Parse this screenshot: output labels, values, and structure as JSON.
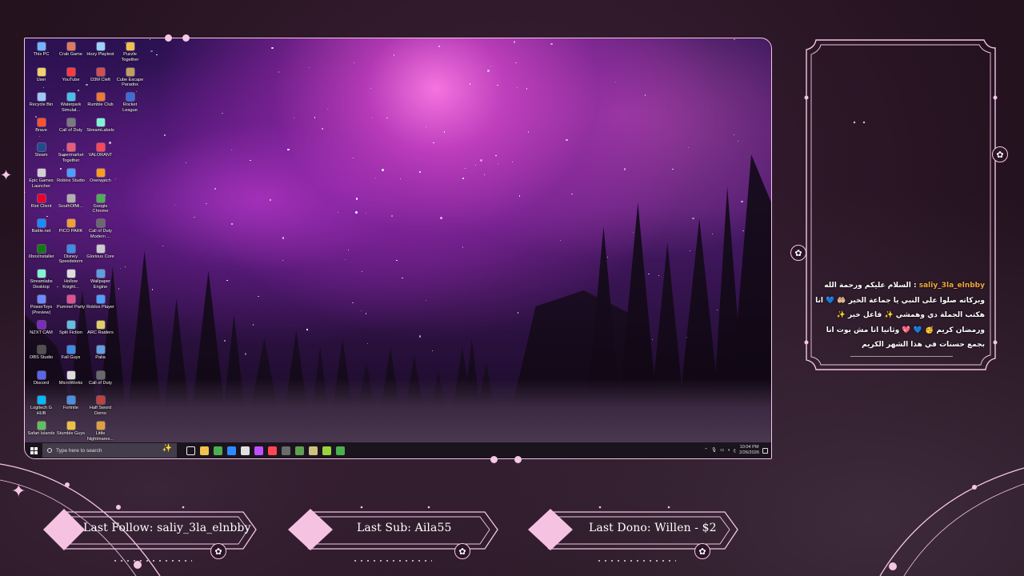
{
  "desktop": {
    "icons": [
      {
        "label": "This PC",
        "icon": "pc-icon",
        "color": "#6fb6ff"
      },
      {
        "label": "Crab Game",
        "icon": "game-icon",
        "color": "#e07a5f"
      },
      {
        "label": "Hozy Playtest",
        "icon": "game-icon",
        "color": "#9bd3ff"
      },
      {
        "label": "Puzzle Together",
        "icon": "game-icon",
        "color": "#f2c14e"
      },
      {
        "label": "User",
        "icon": "user-folder-icon",
        "color": "#f2d16b"
      },
      {
        "label": "YouTube",
        "icon": "youtube-icon",
        "color": "#ff3b3b"
      },
      {
        "label": "D3M Cleft",
        "icon": "game-icon",
        "color": "#d05050"
      },
      {
        "label": "Cube Escape Paradox",
        "icon": "game-icon",
        "color": "#c0a060"
      },
      {
        "label": "Recycle Bin",
        "icon": "recycle-bin-icon",
        "color": "#9cc9f5"
      },
      {
        "label": "Waterpark Simulat...",
        "icon": "game-icon",
        "color": "#4ac0e8"
      },
      {
        "label": "Rumble Club",
        "icon": "game-icon",
        "color": "#f07a30"
      },
      {
        "label": "Rocket League",
        "icon": "game-icon",
        "color": "#3a6fd8"
      },
      {
        "label": "Brave",
        "icon": "brave-icon",
        "color": "#fb542b"
      },
      {
        "label": "Call of Duty",
        "icon": "game-icon",
        "color": "#7a7a7a"
      },
      {
        "label": "StreamLabels",
        "icon": "app-icon",
        "color": "#80f5d2"
      },
      {
        "label": "",
        "icon": "",
        "color": ""
      },
      {
        "label": "Steam",
        "icon": "steam-icon",
        "color": "#1b4f8a"
      },
      {
        "label": "Supermarket Together",
        "icon": "game-icon",
        "color": "#e85d75"
      },
      {
        "label": "VALORANT",
        "icon": "valorant-icon",
        "color": "#ff4655"
      },
      {
        "label": "",
        "icon": "",
        "color": ""
      },
      {
        "label": "Epic Games Launcher",
        "icon": "epic-icon",
        "color": "#d0d0d0"
      },
      {
        "label": "Roblox Studio",
        "icon": "roblox-icon",
        "color": "#4aa0ff"
      },
      {
        "label": "Overwatch",
        "icon": "overwatch-icon",
        "color": "#f99e1a"
      },
      {
        "label": "",
        "icon": "",
        "color": ""
      },
      {
        "label": "Riot Client",
        "icon": "riot-icon",
        "color": "#eb0029"
      },
      {
        "label": "SouthOfMi...",
        "icon": "game-icon",
        "color": "#b0b0b0"
      },
      {
        "label": "Google Chrome",
        "icon": "chrome-icon",
        "color": "#4caf50"
      },
      {
        "label": "",
        "icon": "",
        "color": ""
      },
      {
        "label": "Battle.net",
        "icon": "battlenet-icon",
        "color": "#148eff"
      },
      {
        "label": "PICO PARK",
        "icon": "game-icon",
        "color": "#f0a030"
      },
      {
        "label": "Call of Duty Modern ...",
        "icon": "game-icon",
        "color": "#6a6a6a"
      },
      {
        "label": "",
        "icon": "",
        "color": ""
      },
      {
        "label": "XboxInstaller",
        "icon": "xbox-icon",
        "color": "#107c10"
      },
      {
        "label": "Disney Speedstorm",
        "icon": "game-icon",
        "color": "#3a8ee6"
      },
      {
        "label": "Glorious Core",
        "icon": "app-icon",
        "color": "#cccccc"
      },
      {
        "label": "",
        "icon": "",
        "color": ""
      },
      {
        "label": "Streamlabs Desktop",
        "icon": "streamlabs-icon",
        "color": "#80f5d2"
      },
      {
        "label": "Hollow Knight...",
        "icon": "game-icon",
        "color": "#dddddd"
      },
      {
        "label": "Wallpaper Engine",
        "icon": "app-icon",
        "color": "#5aa0e0"
      },
      {
        "label": "",
        "icon": "",
        "color": ""
      },
      {
        "label": "PowerToys (Preview)",
        "icon": "app-icon",
        "color": "#6a8cff"
      },
      {
        "label": "Pummel Party",
        "icon": "game-icon",
        "color": "#e05090"
      },
      {
        "label": "Roblox Player",
        "icon": "roblox-icon",
        "color": "#4aa0ff"
      },
      {
        "label": "",
        "icon": "",
        "color": ""
      },
      {
        "label": "NZXT CAM",
        "icon": "app-icon",
        "color": "#7b2cbf"
      },
      {
        "label": "Split Fiction",
        "icon": "game-icon",
        "color": "#60c0e0"
      },
      {
        "label": "ARC Raiders",
        "icon": "game-icon",
        "color": "#e0d060"
      },
      {
        "label": "",
        "icon": "",
        "color": ""
      },
      {
        "label": "OBS Studio",
        "icon": "obs-icon",
        "color": "#505050"
      },
      {
        "label": "Fall Guys",
        "icon": "game-icon",
        "color": "#3a8ee6"
      },
      {
        "label": "Palia",
        "icon": "game-icon",
        "color": "#60a0e0"
      },
      {
        "label": "",
        "icon": "",
        "color": ""
      },
      {
        "label": "Discord",
        "icon": "discord-icon",
        "color": "#5865f2"
      },
      {
        "label": "MicroWorks",
        "icon": "app-icon",
        "color": "#dddddd"
      },
      {
        "label": "Call of Duty",
        "icon": "game-icon",
        "color": "#6a6a6a"
      },
      {
        "label": "",
        "icon": "",
        "color": ""
      },
      {
        "label": "Logitech G HUB",
        "icon": "logitech-icon",
        "color": "#00b8fc"
      },
      {
        "label": "Fortnite",
        "icon": "game-icon",
        "color": "#4a90e2"
      },
      {
        "label": "Half Sword Demo",
        "icon": "game-icon",
        "color": "#c04040"
      },
      {
        "label": "",
        "icon": "",
        "color": ""
      },
      {
        "label": "Safari Islands",
        "icon": "game-icon",
        "color": "#60c060"
      },
      {
        "label": "Stumble Guys",
        "icon": "game-icon",
        "color": "#f0c040"
      },
      {
        "label": "Little Nightmares...",
        "icon": "game-icon",
        "color": "#e0a040"
      }
    ]
  },
  "taskbar": {
    "search_placeholder": "Type here to search",
    "apps": [
      "#f3f3f3",
      "#f2c14e",
      "#4caf50",
      "#2c8cff",
      "#e0e0e0",
      "#c050ff",
      "#ff4655",
      "#6a6a6a",
      "#60a050",
      "#d0c080",
      "#9bd33f",
      "#4caf50"
    ],
    "tray": {
      "lang": "ع",
      "time": "10:04 PM",
      "date": "2/26/2026"
    }
  },
  "chat": {
    "username": "saliy_3la_elnbby",
    "separator": ":",
    "message": "السلام عليكم ورحمة الله وبركاته صلوا على النبي يا جماعة الخير 🤲🏼 💙 انا هكتب الجملة دي وهمشي ✨ فاعل خير ✨ ورمضان كريم 🥳 💙 💖 وثانيا انا مش بوت انا بجمع حسنات في هذا الشهر الكريم"
  },
  "alerts": {
    "follow": "Last Follow: saliy_3la_elnbby",
    "sub": "Last Sub: Aila55",
    "dono": "Last Dono: Willen - $2"
  },
  "colors": {
    "accent_pink": "#f4c6e4",
    "background": "#2a1526",
    "chat_username": "#f3a63f"
  }
}
